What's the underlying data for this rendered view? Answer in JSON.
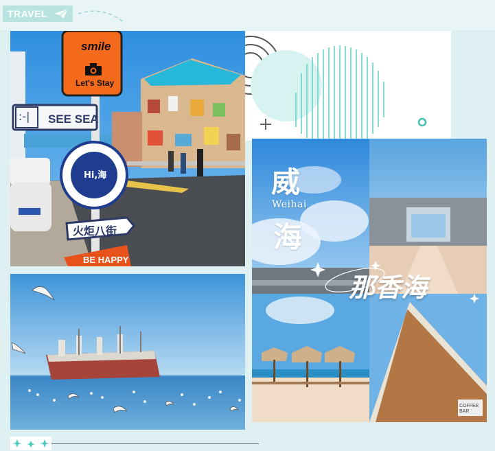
{
  "header": {
    "tag_label": "TRAVEL",
    "tag_color": "#b9e3df"
  },
  "photos": {
    "street": {
      "sign_smile": "smile",
      "sign_lets_stay": "Let's Stay",
      "sign_see_sea": "SEE SEA",
      "badge_text": "Hi,海",
      "sign_street": "火炬八街",
      "sign_be_happy": "BE HAPPY"
    },
    "collage": {
      "city_char_1": "威",
      "city_en": "Weihai",
      "city_char_2": "海",
      "place_name": "那香海",
      "coffee_sign": "COFFEE BAR"
    }
  },
  "colors": {
    "background": "#dff0f3",
    "accent_teal": "#4cc9bd",
    "sky": "#3d8fd6"
  }
}
